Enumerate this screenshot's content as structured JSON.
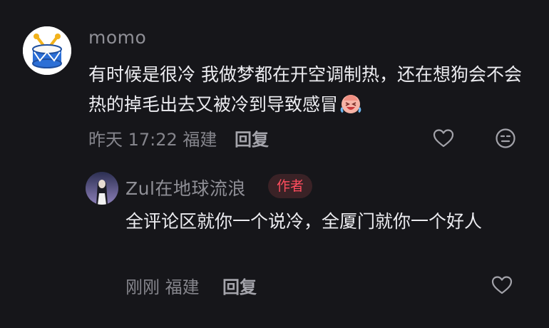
{
  "comments": [
    {
      "username": "momo",
      "avatar_icon": "drum-icon",
      "text": "有时候是很冷 我做梦都在开空调制热，还在想狗会不会热的掉毛出去又被冷到导致感冒",
      "emoji": "crying-laughing-emoji",
      "meta": "昨天 17:22 福建",
      "reply_label": "回复",
      "actions": [
        "heart-icon",
        "smiley-icon"
      ]
    },
    {
      "username": "Zul在地球流浪",
      "badge": "作者",
      "avatar_icon": "avatar-image",
      "text": "全评论区就你一个说冷，全厦门就你一个好人",
      "meta": "刚刚 福建",
      "reply_label": "回复",
      "actions": [
        "heart-icon"
      ]
    }
  ],
  "colors": {
    "background": "#16161a",
    "username": "#8f8f96",
    "badge_text": "#ff4d5e",
    "badge_bg": "#3a2226"
  }
}
